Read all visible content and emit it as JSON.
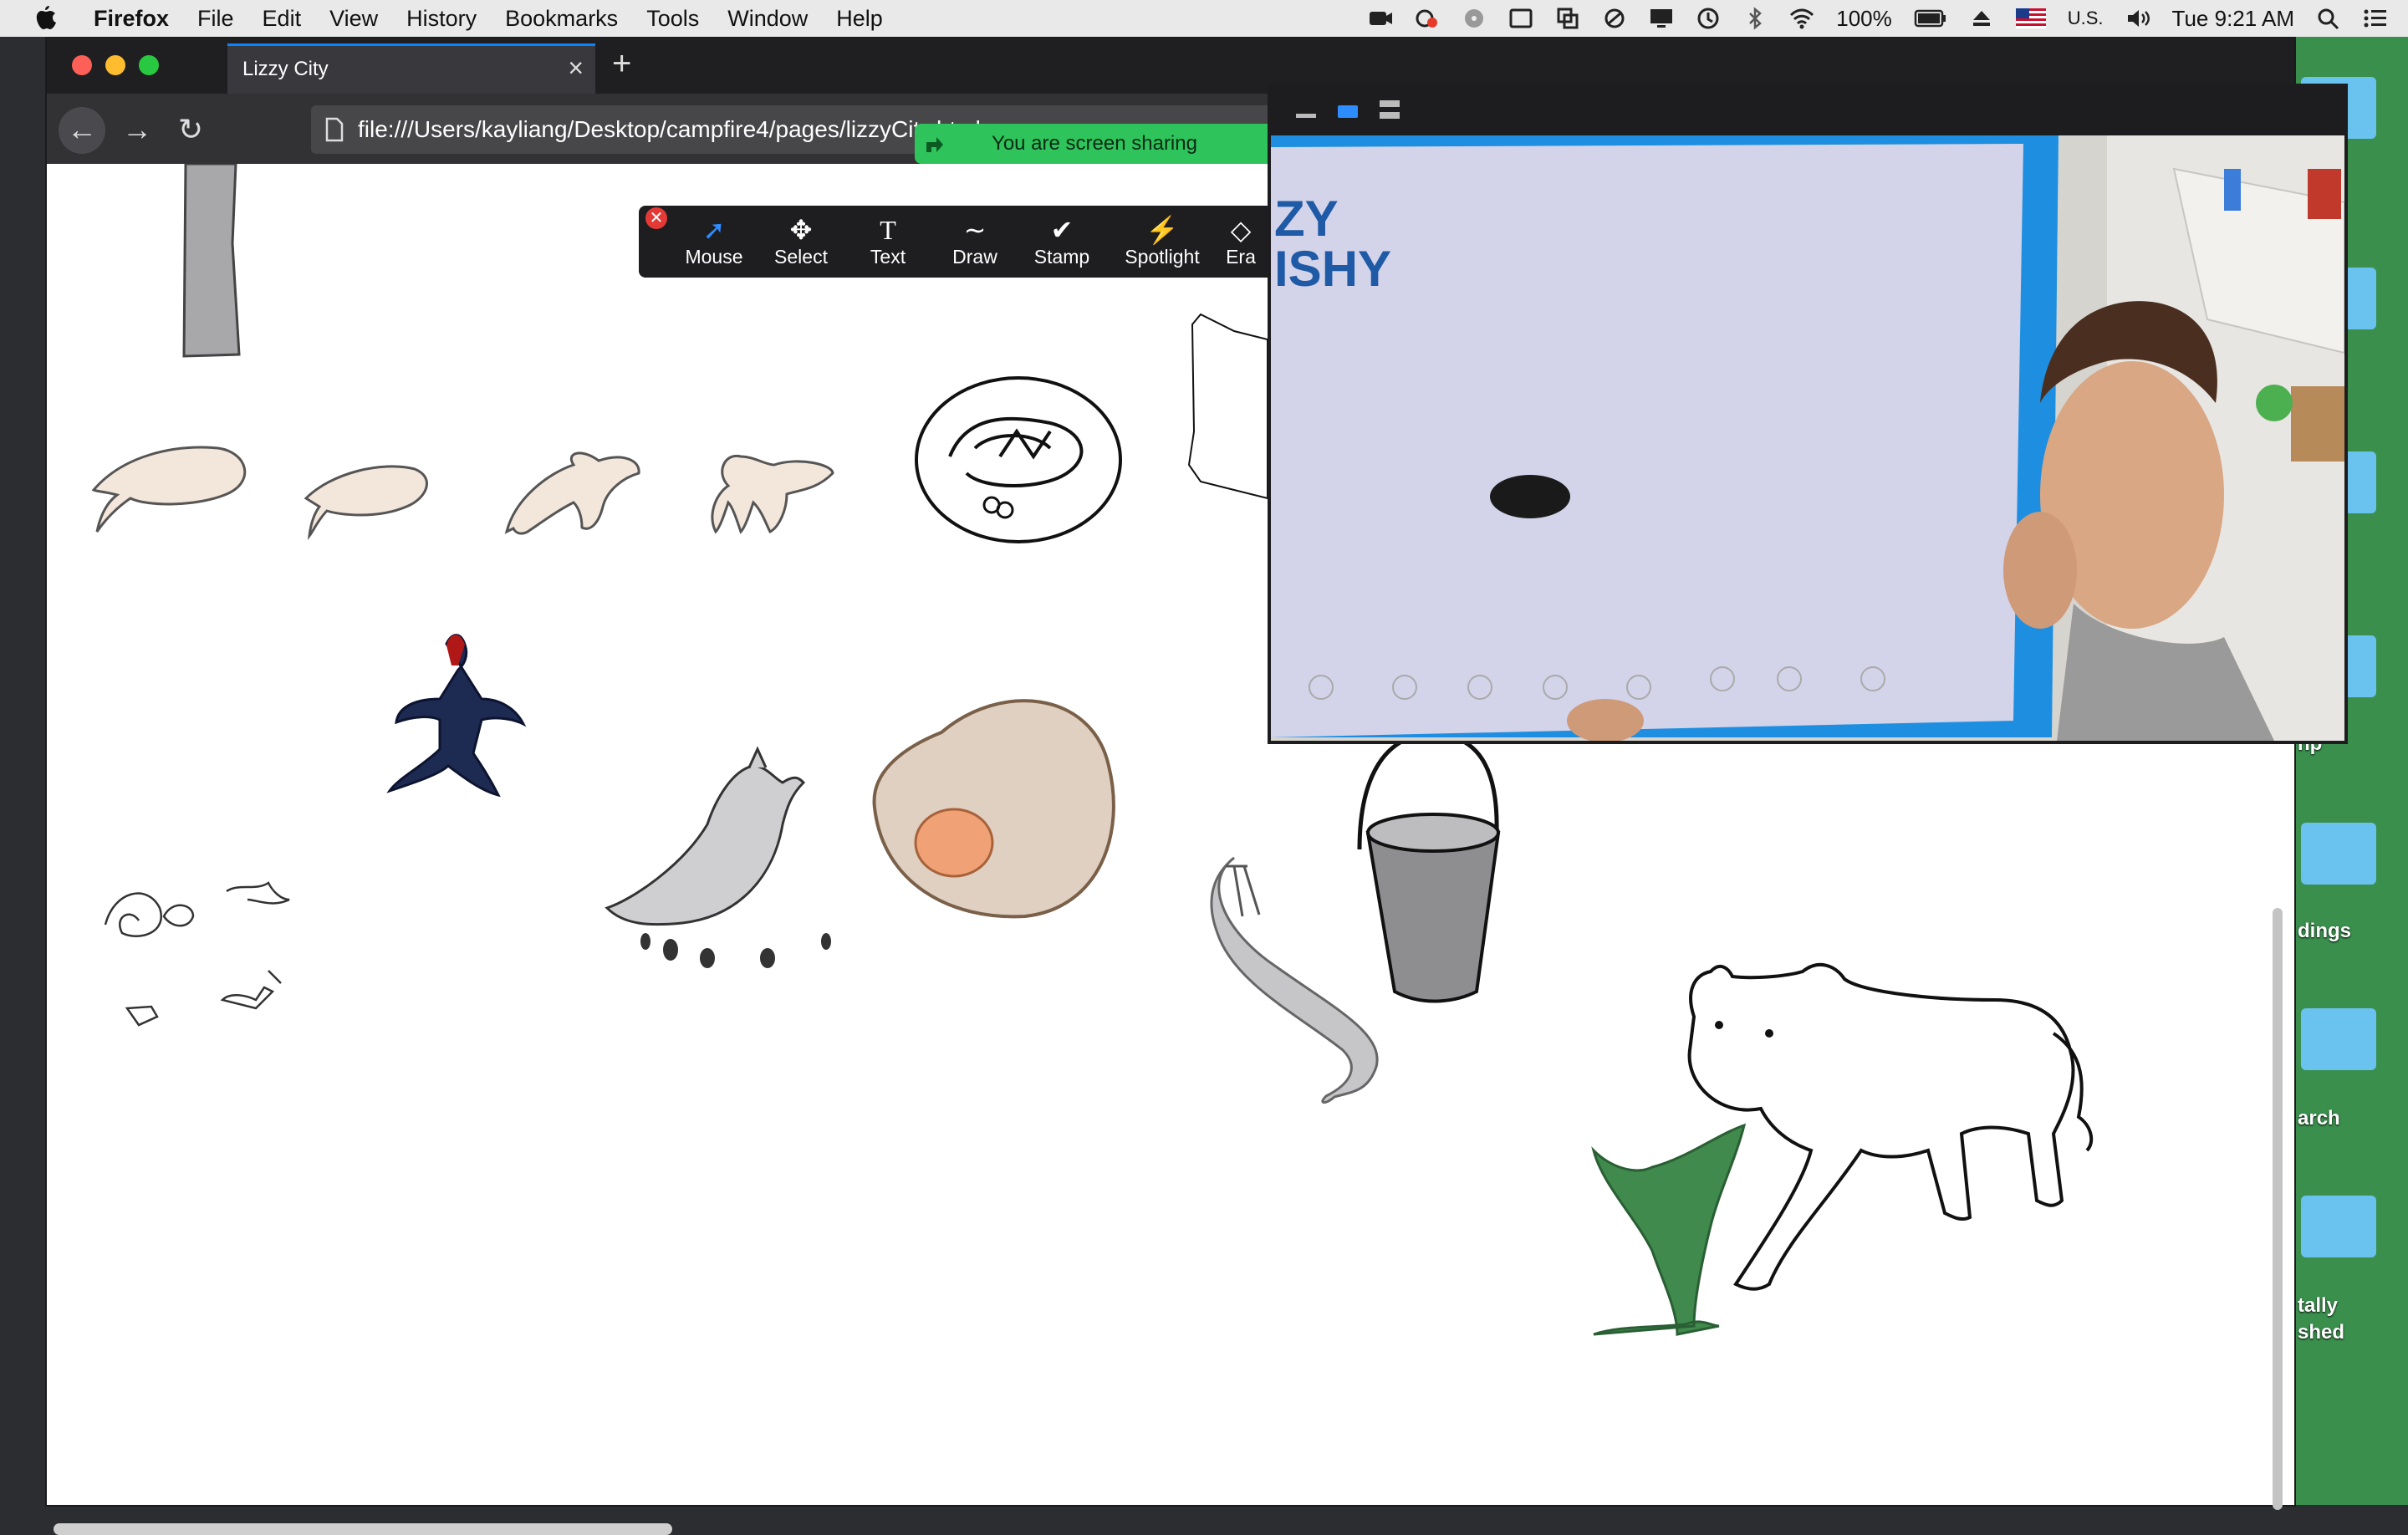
{
  "menubar": {
    "app": "Firefox",
    "items": [
      "File",
      "Edit",
      "View",
      "History",
      "Bookmarks",
      "Tools",
      "Window",
      "Help"
    ],
    "battery": "100%",
    "input_source": "U.S.",
    "clock": "Tue 9:21 AM"
  },
  "browser": {
    "tab_title": "Lizzy City",
    "url": "file:///Users/kayliang/Desktop/campfire4/pages/lizzyCity.html"
  },
  "zoom": {
    "sharing_banner": "You are screen sharing",
    "tools": [
      "Mouse",
      "Select",
      "Text",
      "Draw",
      "Stamp",
      "Spotlight",
      "Era"
    ]
  },
  "desktop": {
    "labels": [
      "np",
      "dings",
      "arch",
      "tally",
      "shed"
    ]
  },
  "colors": {
    "accent": "#0a84ff",
    "share_green": "#2fc35c",
    "frame_blue": "#1e8fe0"
  }
}
